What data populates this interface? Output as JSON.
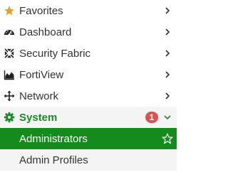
{
  "menu": {
    "items": [
      {
        "label": "Favorites",
        "icon": "star-icon",
        "icon_color": "#e3a32a"
      },
      {
        "label": "Dashboard",
        "icon": "dashboard-icon"
      },
      {
        "label": "Security Fabric",
        "icon": "security-fabric-icon"
      },
      {
        "label": "FortiView",
        "icon": "area-chart-icon"
      },
      {
        "label": "Network",
        "icon": "network-arrows-icon"
      }
    ],
    "system": {
      "label": "System",
      "icon": "gear-icon",
      "badge": "1",
      "color": "#1c8a2a",
      "badge_color": "#d9534f"
    },
    "subitems": [
      {
        "label": "Administrators",
        "active": true,
        "highlight": "#158b1e"
      },
      {
        "label": "Admin Profiles",
        "active": false
      }
    ]
  }
}
